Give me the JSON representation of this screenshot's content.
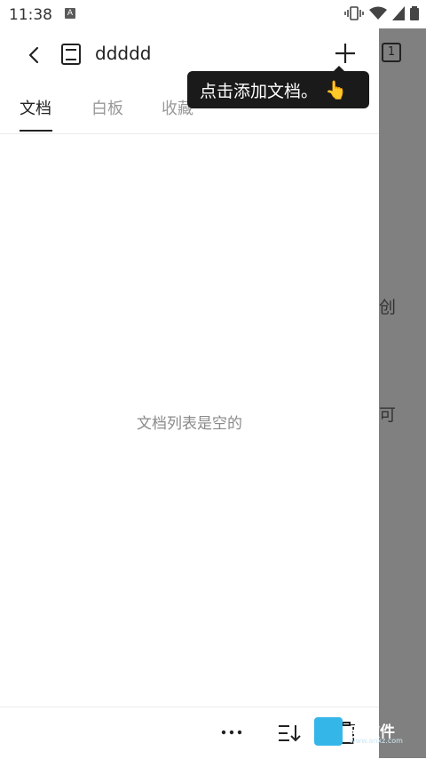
{
  "status_bar": {
    "time": "11:38",
    "notification_icon": "A"
  },
  "app_bar": {
    "notebook_title": "ddddd",
    "notebook_count": "1"
  },
  "tabs": [
    {
      "label": "文档",
      "active": true
    },
    {
      "label": "白板",
      "active": false
    },
    {
      "label": "收藏",
      "active": false
    }
  ],
  "empty_state": "文档列表是空的",
  "tooltip": {
    "text": "点击添加文档。",
    "hand": "👆"
  },
  "overlay": {
    "line1": "创",
    "line2": "可"
  },
  "watermark": {
    "text": "安软件",
    "sub": "www.anxz.com"
  },
  "icons": {
    "back": "chevron-left-icon",
    "notebook": "notebook-icon",
    "add": "plus-icon",
    "more": "more-horizontal-icon",
    "sort": "sort-icon",
    "trash": "trash-icon"
  },
  "colors": {
    "overlay": "#808080",
    "tooltip_bg": "#1a1a1a",
    "empty_text": "#8a8a8a"
  }
}
